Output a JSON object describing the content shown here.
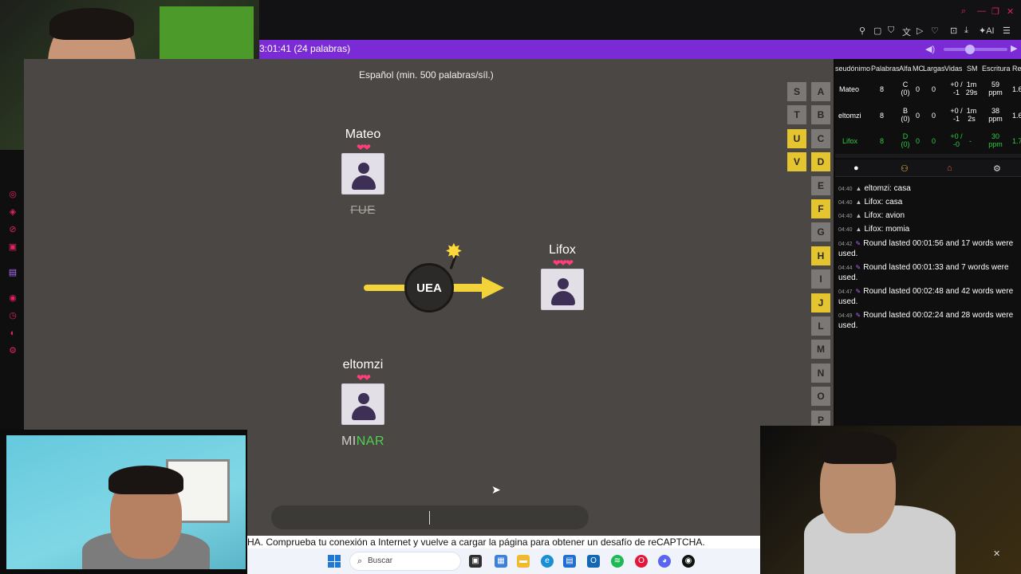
{
  "status_bar": {
    "text": "3:01:41 (24 palabras)"
  },
  "game": {
    "rule": "Español (min. 500 palabras/síl.)",
    "syllable": "UEA",
    "players": [
      {
        "name": "Mateo",
        "lives": 2,
        "word": "FUE"
      },
      {
        "name": "Lifox",
        "lives": 3,
        "word": ""
      },
      {
        "name": "eltomzi",
        "lives": 2,
        "word_prefix": "MI",
        "word_suffix": "NAR"
      }
    ],
    "hearts": {
      "two": "❤❤",
      "three": "❤❤❤"
    },
    "letters": [
      {
        "l": "S",
        "on": false
      },
      {
        "l": "A",
        "on": false
      },
      {
        "l": "T",
        "on": false
      },
      {
        "l": "B",
        "on": false
      },
      {
        "l": "U",
        "on": true
      },
      {
        "l": "C",
        "on": false
      },
      {
        "l": "V",
        "on": true
      },
      {
        "l": "D",
        "on": true
      },
      {
        "l": "E",
        "on": false
      },
      {
        "l": "F",
        "on": true
      },
      {
        "l": "G",
        "on": false
      },
      {
        "l": "H",
        "on": true
      },
      {
        "l": "I",
        "on": false
      },
      {
        "l": "J",
        "on": true
      },
      {
        "l": "L",
        "on": false
      },
      {
        "l": "M",
        "on": false
      },
      {
        "l": "N",
        "on": false
      },
      {
        "l": "O",
        "on": false
      },
      {
        "l": "P",
        "on": false
      }
    ],
    "colors": {
      "active_letter": "#e4c530",
      "inactive_letter": "#7b7875",
      "minar_green": "#4fd14f",
      "lifox": "#2ecc40"
    }
  },
  "scoreboard": {
    "headers": [
      "seudónimo",
      "Palabras",
      "Alfa",
      "MC",
      "Largas",
      "Vidas",
      "SM",
      "Escritura",
      "Re"
    ],
    "rows": [
      {
        "name": "Mateo",
        "words": "8",
        "alfa": "C (0)",
        "mc": "0",
        "largas": "0",
        "vidas": "+0 / -1",
        "sm": "1m 29s",
        "escritura": "59 ppm",
        "re": "1.6"
      },
      {
        "name": "eltomzi",
        "words": "8",
        "alfa": "B (0)",
        "mc": "0",
        "largas": "0",
        "vidas": "+0 / -1",
        "sm": "1m 2s",
        "escritura": "38 ppm",
        "re": "1.6"
      },
      {
        "name": "Lifox",
        "words": "8",
        "alfa": "D (0)",
        "mc": "0",
        "largas": "0",
        "vidas": "+0 / -0",
        "sm": "-",
        "escritura": "30 ppm",
        "re": "1.7"
      }
    ]
  },
  "chat": {
    "lines": [
      {
        "time": "04:40",
        "kind": "user",
        "text": "eltomzi: casa"
      },
      {
        "time": "04:40",
        "kind": "user",
        "text": "Lifox: casa"
      },
      {
        "time": "04:40",
        "kind": "user",
        "text": "Lifox: avion"
      },
      {
        "time": "04:40",
        "kind": "user",
        "text": "Lifox: momia"
      },
      {
        "time": "04:42",
        "kind": "system",
        "text": "Round lasted 00:01:56 and 17 words were used."
      },
      {
        "time": "04:44",
        "kind": "system",
        "text": "Round lasted 00:01:33 and 7 words were used."
      },
      {
        "time": "04:47",
        "kind": "system",
        "text": "Round lasted 00:02:48 and 42 words were used."
      },
      {
        "time": "04:49",
        "kind": "system",
        "text": "Round lasted 00:02:24 and 28 words were used."
      }
    ]
  },
  "recaptcha": {
    "text": "HA. Comprueba tu conexión a Internet y vuelve a cargar la página para obtener un desafío de reCAPTCHA."
  },
  "taskbar": {
    "search_placeholder": "Buscar"
  },
  "icons": {
    "volume": "volume-icon",
    "play": "play-icon",
    "chat": "chat-icon",
    "users": "users-icon",
    "home": "home-icon",
    "settings": "gear-icon",
    "bomb_spark": "spark-icon"
  }
}
